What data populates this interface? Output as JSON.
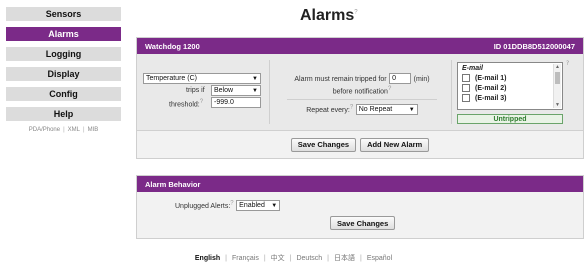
{
  "sidebar": {
    "items": [
      {
        "label": "Sensors"
      },
      {
        "label": "Alarms"
      },
      {
        "label": "Logging"
      },
      {
        "label": "Display"
      },
      {
        "label": "Config"
      },
      {
        "label": "Help"
      }
    ],
    "links": [
      "PDA/Phone",
      "XML",
      "MIB"
    ]
  },
  "page": {
    "title": "Alarms",
    "help_mark": "?"
  },
  "alarm": {
    "header_left": "Watchdog 1200",
    "header_right": "ID 01DDB8D512000047",
    "sensor_select": "Temperature (C)",
    "trips_if_label": "trips if",
    "condition_select": "Below",
    "threshold_label": "threshold:",
    "threshold_value": "-999.0",
    "tripped_label_pre": "Alarm must remain tripped for",
    "tripped_value": "0",
    "tripped_unit": "(min)",
    "tripped_label_post": "before notification",
    "repeat_label": "Repeat every:",
    "repeat_select": "No Repeat",
    "email_header": "E-mail",
    "emails": [
      "(E-mail 1)",
      "(E-mail 2)",
      "(E-mail 3)"
    ],
    "status": "Untripped",
    "save_label": "Save Changes",
    "add_label": "Add New Alarm"
  },
  "behavior": {
    "header": "Alarm Behavior",
    "unplugged_label": "Unplugged Alerts:",
    "unplugged_select": "Enabled",
    "save_label": "Save Changes"
  },
  "languages": [
    "English",
    "Français",
    "中文",
    "Deutsch",
    "日本語",
    "Español"
  ],
  "colors": {
    "accent": "#7b2a88",
    "status_green": "#2f7d2f"
  }
}
